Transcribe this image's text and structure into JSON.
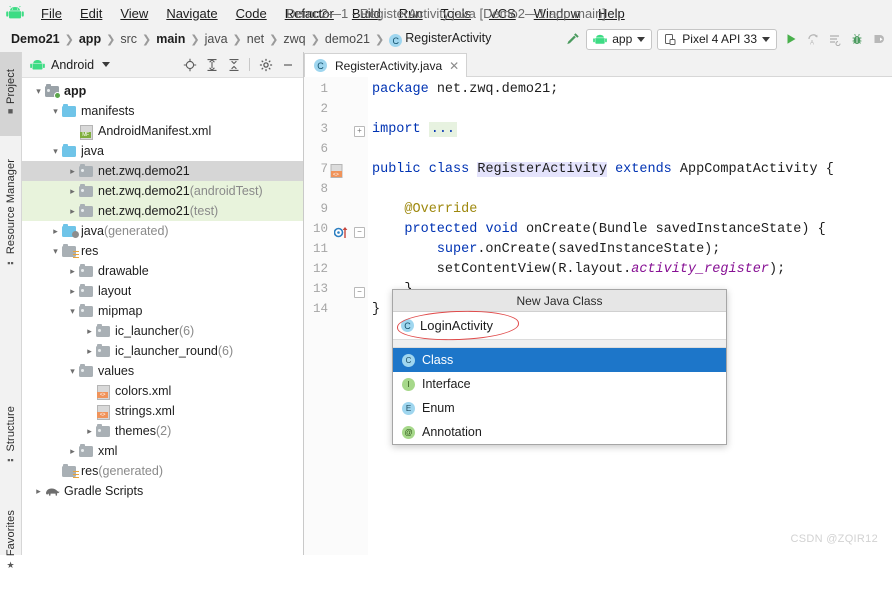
{
  "window": {
    "title": "Demo2—1 - RegisterActivity.java [Demo2—1.app.main]",
    "app_icon": "android-robot-icon"
  },
  "menubar": {
    "items": [
      {
        "label": "File"
      },
      {
        "label": "Edit"
      },
      {
        "label": "View"
      },
      {
        "label": "Navigate"
      },
      {
        "label": "Code"
      },
      {
        "label": "Refactor"
      },
      {
        "label": "Build"
      },
      {
        "label": "Run"
      },
      {
        "label": "Tools"
      },
      {
        "label": "VCS"
      },
      {
        "label": "Window"
      },
      {
        "label": "Help"
      }
    ]
  },
  "breadcrumb": {
    "items": [
      {
        "label": "Demo21",
        "bold": true
      },
      {
        "label": "app",
        "bold": true
      },
      {
        "label": "src",
        "bold": false
      },
      {
        "label": "main",
        "bold": true
      },
      {
        "label": "java",
        "bold": false
      },
      {
        "label": "net",
        "bold": false
      },
      {
        "label": "zwq",
        "bold": false
      },
      {
        "label": "demo21",
        "bold": false
      },
      {
        "label": "RegisterActivity",
        "bold": false,
        "badge": "C"
      }
    ],
    "separator": "❯"
  },
  "toolbar": {
    "hammer_icon": "build-hammer-icon",
    "module_selector": {
      "label": "app",
      "icon": "android-robot-icon"
    },
    "device_selector": {
      "label": "Pixel 4 API 33",
      "icon": "device-phone-icon"
    },
    "actions": [
      {
        "name": "run-button",
        "icon": "play-triangle-icon"
      },
      {
        "name": "apply-changes-button",
        "icon": "apply-changes-icon"
      },
      {
        "name": "run-with-coverage-button",
        "icon": "coverage-icon"
      },
      {
        "name": "debug-button",
        "icon": "bug-icon"
      },
      {
        "name": "attach-debugger-button",
        "icon": "attach-debugger-icon"
      }
    ]
  },
  "tool_strip": {
    "tabs": [
      {
        "label": "Project",
        "active": true,
        "icon": "project-folder-icon"
      },
      {
        "label": "Resource Manager",
        "active": false,
        "icon": "resource-manager-icon"
      },
      {
        "label": "Structure",
        "active": false,
        "icon": "structure-icon"
      },
      {
        "label": "Favorites",
        "active": false,
        "icon": "star-icon"
      }
    ]
  },
  "project_panel": {
    "title": "Android",
    "icon": "android-robot-icon",
    "header_icons": [
      {
        "name": "locate-target-icon"
      },
      {
        "name": "expand-all-icon"
      },
      {
        "name": "collapse-all-icon"
      },
      {
        "name": "gear-icon"
      },
      {
        "name": "minimize-icon"
      }
    ],
    "tree": [
      {
        "label": "app",
        "suffix": "",
        "indent": 0,
        "arrow": "down",
        "icon": "module-folder-icon",
        "bold": true,
        "state": "none"
      },
      {
        "label": "manifests",
        "suffix": "",
        "indent": 1,
        "arrow": "down",
        "icon": "blue-folder-icon",
        "bold": false,
        "state": "none"
      },
      {
        "label": "AndroidManifest.xml",
        "suffix": "",
        "indent": 2,
        "arrow": "none",
        "icon": "manifest-file-icon",
        "bold": false,
        "state": "none"
      },
      {
        "label": "java",
        "suffix": "",
        "indent": 1,
        "arrow": "down",
        "icon": "blue-folder-icon",
        "bold": false,
        "state": "none"
      },
      {
        "label": "net.zwq.demo21",
        "suffix": "",
        "indent": 2,
        "arrow": "right",
        "icon": "package-folder-icon",
        "bold": false,
        "state": "selected"
      },
      {
        "label": "net.zwq.demo21",
        "suffix": " (androidTest)",
        "indent": 2,
        "arrow": "right",
        "icon": "package-folder-icon",
        "bold": false,
        "state": "test"
      },
      {
        "label": "net.zwq.demo21",
        "suffix": " (test)",
        "indent": 2,
        "arrow": "right",
        "icon": "package-folder-icon",
        "bold": false,
        "state": "test"
      },
      {
        "label": "java",
        "suffix": " (generated)",
        "indent": 1,
        "arrow": "right",
        "icon": "generated-folder-icon",
        "bold": false,
        "state": "none"
      },
      {
        "label": "res",
        "suffix": "",
        "indent": 1,
        "arrow": "down",
        "icon": "res-folder-icon",
        "bold": false,
        "state": "none"
      },
      {
        "label": "drawable",
        "suffix": "",
        "indent": 2,
        "arrow": "right",
        "icon": "package-folder-icon",
        "bold": false,
        "state": "none"
      },
      {
        "label": "layout",
        "suffix": "",
        "indent": 2,
        "arrow": "right",
        "icon": "package-folder-icon",
        "bold": false,
        "state": "none"
      },
      {
        "label": "mipmap",
        "suffix": "",
        "indent": 2,
        "arrow": "down",
        "icon": "package-folder-icon",
        "bold": false,
        "state": "none"
      },
      {
        "label": "ic_launcher",
        "suffix": " (6)",
        "indent": 3,
        "arrow": "right",
        "icon": "package-folder-icon",
        "bold": false,
        "state": "none"
      },
      {
        "label": "ic_launcher_round",
        "suffix": " (6)",
        "indent": 3,
        "arrow": "right",
        "icon": "package-folder-icon",
        "bold": false,
        "state": "none"
      },
      {
        "label": "values",
        "suffix": "",
        "indent": 2,
        "arrow": "down",
        "icon": "package-folder-icon",
        "bold": false,
        "state": "none"
      },
      {
        "label": "colors.xml",
        "suffix": "",
        "indent": 3,
        "arrow": "none",
        "icon": "xml-file-icon",
        "bold": false,
        "state": "none"
      },
      {
        "label": "strings.xml",
        "suffix": "",
        "indent": 3,
        "arrow": "none",
        "icon": "xml-file-icon",
        "bold": false,
        "state": "none"
      },
      {
        "label": "themes",
        "suffix": " (2)",
        "indent": 3,
        "arrow": "right",
        "icon": "package-folder-icon",
        "bold": false,
        "state": "none"
      },
      {
        "label": "xml",
        "suffix": "",
        "indent": 2,
        "arrow": "right",
        "icon": "package-folder-icon",
        "bold": false,
        "state": "none"
      },
      {
        "label": "res",
        "suffix": " (generated)",
        "indent": 1,
        "arrow": "none",
        "icon": "res-folder-icon",
        "bold": false,
        "state": "none"
      },
      {
        "label": "Gradle Scripts",
        "suffix": "",
        "indent": 0,
        "arrow": "right",
        "icon": "gradle-elephant-icon",
        "bold": false,
        "state": "none"
      }
    ]
  },
  "editor": {
    "tab": {
      "label": "RegisterActivity.java",
      "badge": "C",
      "close": "✕"
    },
    "lines": [
      {
        "num": "1",
        "text": "package net.zwq.demo21;"
      },
      {
        "num": "2",
        "text": ""
      },
      {
        "num": "3",
        "text": "import ..."
      },
      {
        "num": "6",
        "text": ""
      },
      {
        "num": "7",
        "text": "public class RegisterActivity extends AppCompatActivity {"
      },
      {
        "num": "8",
        "text": ""
      },
      {
        "num": "9",
        "text": "    @Override"
      },
      {
        "num": "10",
        "text": "    protected void onCreate(Bundle savedInstanceState) {"
      },
      {
        "num": "11",
        "text": "        super.onCreate(savedInstanceState);"
      },
      {
        "num": "12",
        "text": "        setContentView(R.layout.activity_register);"
      },
      {
        "num": "13",
        "text": "    }"
      },
      {
        "num": "14",
        "text": "}"
      }
    ]
  },
  "popup": {
    "title": "New Java Class",
    "input": {
      "value": "LoginActivity",
      "badge": "C"
    },
    "options": [
      {
        "label": "Class",
        "badge": "C",
        "selected": true
      },
      {
        "label": "Interface",
        "badge": "I",
        "selected": false
      },
      {
        "label": "Enum",
        "badge": "E",
        "selected": false
      },
      {
        "label": "Annotation",
        "badge": "@",
        "selected": false
      }
    ],
    "annotation": "red-ellipse-highlight"
  },
  "watermark": {
    "text": "CSDN @ZQIR12"
  },
  "colors": {
    "accent_blue": "#1d76c9",
    "keyword_blue": "#0033b3",
    "field_purple": "#871094",
    "annotation_gold": "#9e880d",
    "test_green": "#e8f3dc",
    "selection_gray": "#d6d6d6",
    "highlight_row": "#fdf6e3",
    "red_ellipse": "#e04b4b"
  }
}
